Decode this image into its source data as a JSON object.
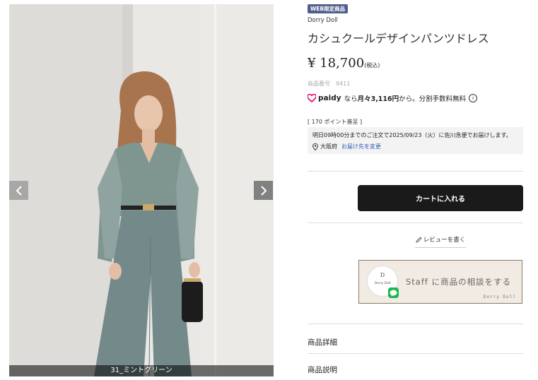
{
  "gallery": {
    "color_caption": "31_ミントグリーン",
    "prev_icon": "chevron-left-icon",
    "next_icon": "chevron-right-icon"
  },
  "product": {
    "badge": "WEB限定商品",
    "brand": "Dorry Doll",
    "title": "カシュクールデザインパンツドレス",
    "price": "¥ 18,700",
    "tax_label": "(税込)",
    "number_label": "商品番号",
    "number_value": "9411"
  },
  "paidy": {
    "logo_text": "paidy",
    "prefix": "なら",
    "monthly": "月々3,116円",
    "suffix": "から。分割手数料無料",
    "info_icon": "i"
  },
  "points": {
    "text": "[ 170 ポイント進呈 ]"
  },
  "delivery": {
    "message": "明日09時00分までのご注文で2025/09/23（火）に佐川急便でお届けします。",
    "location": "大阪府",
    "change_link": "お届け先を変更"
  },
  "actions": {
    "cart_label": "カートに入れる",
    "review_label": "レビューを書く"
  },
  "staff_banner": {
    "logo_mark": "D",
    "logo_name": "Dorry Doll",
    "text": "Staff に商品の相談をする",
    "brand": "Dorry Doll"
  },
  "sections": {
    "details": "商品詳細",
    "description": "商品説明"
  },
  "colors": {
    "badge_bg": "#4f5f8e",
    "cart_bg": "#1a1a1a",
    "link": "#2b5cb8",
    "paidy_pink": "#e5006e",
    "line_green": "#19b84b",
    "dress": "#7e9590"
  }
}
